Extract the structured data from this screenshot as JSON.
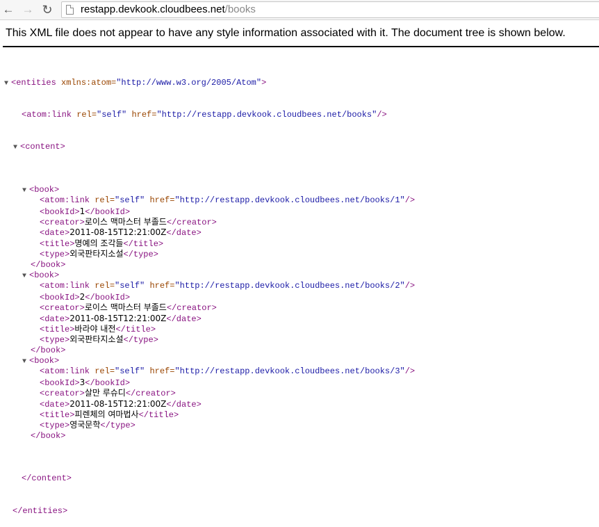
{
  "browser": {
    "url_host": "restapp.devkook.cloudbees.net",
    "url_path": "/books",
    "back_icon": "arrow-left-icon",
    "forward_icon": "arrow-right-icon",
    "reload_icon": "reload-icon"
  },
  "notice": "This XML file does not appear to have any style information associated with it. The document tree is shown below.",
  "xml": {
    "entities_open": "<entities",
    "entities_attr": " xmlns:atom=",
    "entities_val": "\"http://www.w3.org/2005/Atom\"",
    "entities_close": ">",
    "link_open": "<atom:link",
    "rel_attr": " rel=",
    "rel_val": "\"self\"",
    "href_attr": " href=",
    "top_href": "\"http://restapp.devkook.cloudbees.net/books\"",
    "self_close": "/>",
    "content_open": "<content>",
    "content_close": "</content>",
    "entities_end": "</entities>",
    "book_open": "<book>",
    "book_close": "</book>",
    "bookId_open": "<bookId>",
    "bookId_close": "</bookId>",
    "creator_open": "<creator>",
    "creator_close": "</creator>",
    "date_open": "<date>",
    "date_close": "</date>",
    "title_open": "<title>",
    "title_close": "</title>",
    "type_open": "<type>",
    "type_close": "</type>",
    "books": [
      {
        "href": "\"http://restapp.devkook.cloudbees.net/books/1\"",
        "bookId": "1",
        "creator": "로이스 맥마스터 부졸드",
        "date": "2011-08-15T12:21:00Z",
        "title": "명예의 조각들",
        "type": "외국판타지소설"
      },
      {
        "href": "\"http://restapp.devkook.cloudbees.net/books/2\"",
        "bookId": "2",
        "creator": "로이스 맥마스터 부졸드",
        "date": "2011-08-15T12:21:00Z",
        "title": "바라야 내전",
        "type": "외국판타지소설"
      },
      {
        "href": "\"http://restapp.devkook.cloudbees.net/books/3\"",
        "bookId": "3",
        "creator": "살만 루슈디",
        "date": "2011-08-15T12:21:00Z",
        "title": "피렌체의 여마법사",
        "type": "영국문학"
      }
    ]
  }
}
